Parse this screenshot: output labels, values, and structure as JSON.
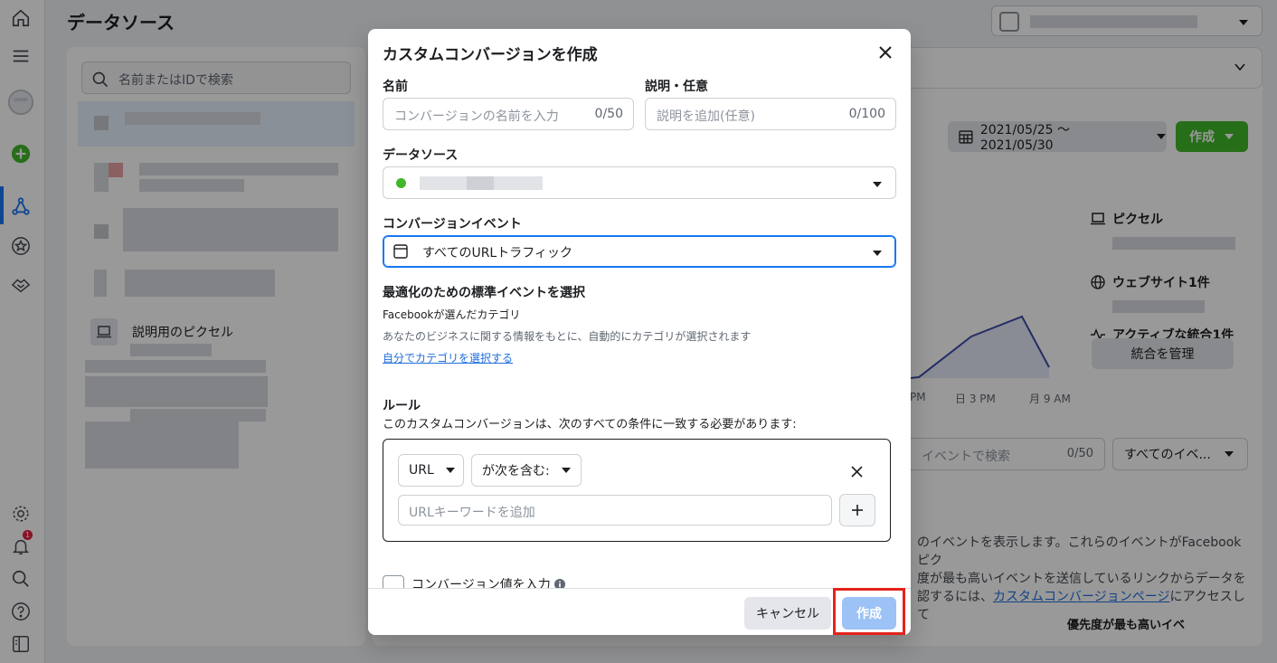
{
  "background": {
    "page_title": "データソース",
    "search_placeholder": "名前またはIDで検索",
    "pixel_item_label": "説明用のピクセル",
    "date_range": "2021/05/25 〜 2021/05/30",
    "create_label": "作成",
    "side_info": {
      "pixel": "ピクセル",
      "website": "ウェブサイト1件",
      "integrations": "アクティブな統合1件",
      "manage_button": "統合を管理"
    },
    "chart_ticks": [
      "PM",
      "日 3 PM",
      "月 9 AM"
    ],
    "event_search_placeholder": "イベントで検索",
    "event_search_count": "0/50",
    "event_filter": "すべてのイベ...",
    "description_prefix": "のイベントを表示します。これらのイベントがFacebookピク",
    "description_mid": "度が最も高いイベントを送信しているリンクからデータを",
    "description_pre_link": "認するには、",
    "description_link": "カスタムコンバージョンページ",
    "description_post_link": "にアクセスして",
    "priority_label": "優先度が最も高いイベ"
  },
  "notifications": {
    "count": "1"
  },
  "modal": {
    "title": "カスタムコンバージョンを作成",
    "name": {
      "label": "名前",
      "placeholder": "コンバージョンの名前を入力",
      "counter": "0/50"
    },
    "description": {
      "label": "説明・任意",
      "placeholder": "説明を追加(任意)",
      "counter": "0/100"
    },
    "data_source": {
      "label": "データソース"
    },
    "conversion_event": {
      "label": "コンバージョンイベント",
      "value": "すべてのURLトラフィック"
    },
    "optimization": {
      "heading": "最適化のための標準イベントを選択",
      "category_text": "Facebookが選んだカテゴリ",
      "category_help": "あなたのビジネスに関する情報をもとに、自動的にカテゴリが選択されます",
      "select_link": "自分でカテゴリを選択する"
    },
    "rules": {
      "heading": "ルール",
      "subtitle": "このカスタムコンバージョンは、次のすべての条件に一致する必要があります:",
      "field": "URL",
      "operator": "が次を含む:",
      "keyword_placeholder": "URLキーワードを追加"
    },
    "conversion_value_label": "コンバージョン値を入力",
    "cancel_label": "キャンセル",
    "create_label": "作成"
  },
  "colors": {
    "accent": "#1877f2",
    "create_green": "#42b72a",
    "disabled_blue": "#9cc2f6",
    "highlight_red": "#e4231a"
  }
}
